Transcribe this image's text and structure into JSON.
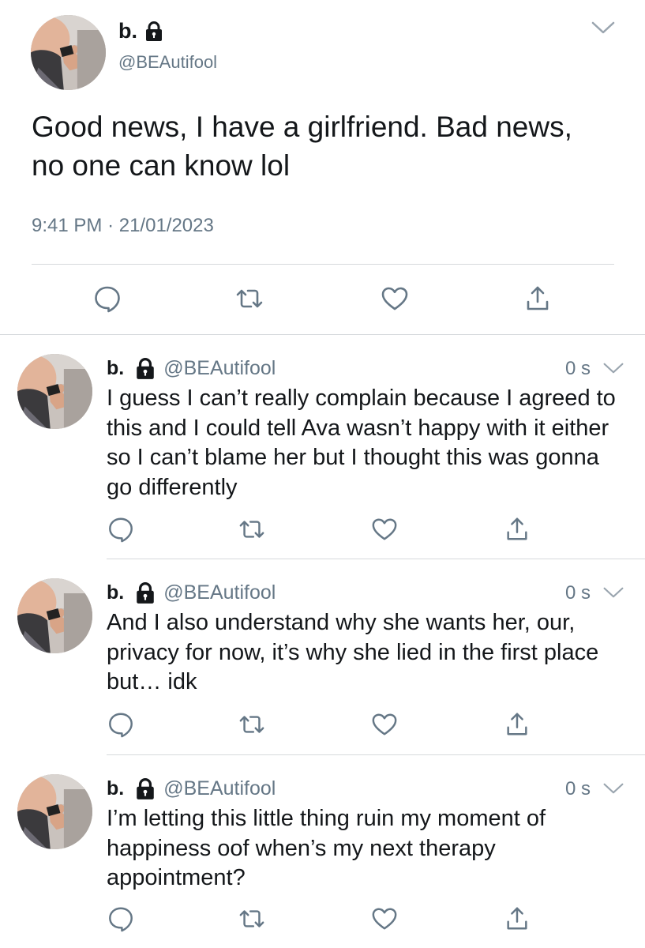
{
  "main_tweet": {
    "name": "b.",
    "handle": "@BEAutifool",
    "text": "Good news, I have a girlfriend. Bad news, no one can know lol",
    "time": "9:41 PM",
    "separator": "·",
    "date": "21/01/2023",
    "icons": {
      "lock": "lock-icon",
      "menu": "chevron-down-icon",
      "reply": "reply-icon",
      "retweet": "retweet-icon",
      "like": "heart-icon",
      "share": "share-icon"
    }
  },
  "replies": [
    {
      "name": "b.",
      "handle": "@BEAutifool",
      "time": "0 s",
      "text": "I guess I can’t really complain because I agreed to this and I could tell Ava wasn’t happy with it either so I can’t blame her but I thought this was gonna go differently"
    },
    {
      "name": "b.",
      "handle": "@BEAutifool",
      "time": "0 s",
      "text": "And I also understand why she wants her, our, privacy for now, it’s why she lied in the first place but… idk"
    },
    {
      "name": "b.",
      "handle": "@BEAutifool",
      "time": "0 s",
      "text": "I’m letting this little thing ruin my moment of happiness oof when’s my next therapy appointment?"
    }
  ],
  "colors": {
    "text": "#14171a",
    "secondary": "#657786",
    "divider": "#d6d9dc",
    "icon": "#657786"
  }
}
